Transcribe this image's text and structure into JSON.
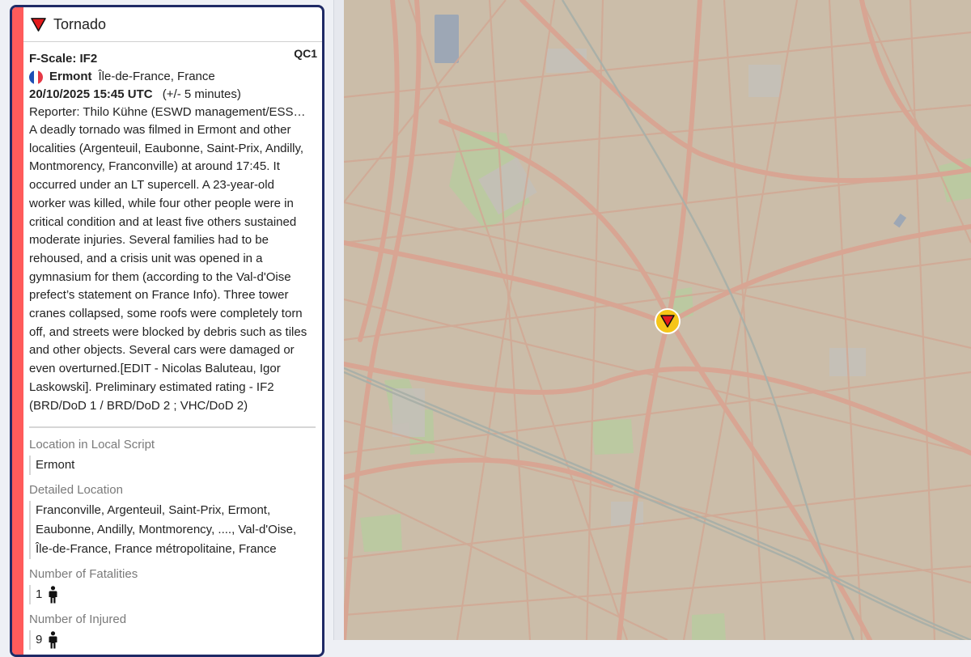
{
  "report": {
    "type": "Tornado",
    "qc": "QC1",
    "fscale": "F-Scale: IF2",
    "city": "Ermont",
    "region": "Île-de-France, France",
    "datetime": "20/10/2025 15:45 UTC",
    "tolerance": "(+/- 5 minutes)",
    "reporter": "Reporter: Thilo Kühne (ESWD management/ESSL Team)",
    "description": "A deadly tornado was filmed in Ermont and other localities (Argenteuil, Eaubonne, Saint-Prix, Andilly, Montmorency, Franconville) at around 17:45. It occurred under an LT supercell. A 23-year-old worker was killed, while four other people were in critical condition and at least five others sustained moderate injuries. Several families had to be rehoused, and a crisis unit was opened in a gymnasium for them (according to the Val-d'Oise prefect’s statement on France Info). Three tower cranes collapsed, some roofs were completely torn off, and streets were blocked by debris such as tiles and other objects. Several cars were damaged or even overturned.[EDIT - Nicolas Baluteau, Igor Laskowski]. Preliminary estimated rating - IF2 (BRD/DoD 1 / BRD/DoD 2 ; VHC/DoD 2)",
    "fields": {
      "local_script_label": "Location in Local Script",
      "local_script_value": "Ermont",
      "detailed_location_label": "Detailed Location",
      "detailed_location_value": "Franconville, Argenteuil, Saint-Prix, Ermont, Eaubonne, Andilly, Montmorency, ...., Val-d'Oise, Île-de-France, France métropolitaine, France",
      "fatalities_label": "Number of Fatalities",
      "fatalities_value": "1",
      "injured_label": "Number of Injured",
      "injured_value": "9"
    }
  },
  "icons": {
    "event": "tornado-triangle-icon",
    "flag": "france-flag-icon",
    "person": "person-icon",
    "map_marker": "tornado-marker-icon"
  },
  "colors": {
    "accent_stripe": "#ff5b5b",
    "card_border": "#1f2a66",
    "tornado_red": "#e41a1c",
    "marker_ring": "#f5c518",
    "map_background": "#cbbda9",
    "map_road": "#d8a593",
    "map_park": "#b9caa0"
  }
}
